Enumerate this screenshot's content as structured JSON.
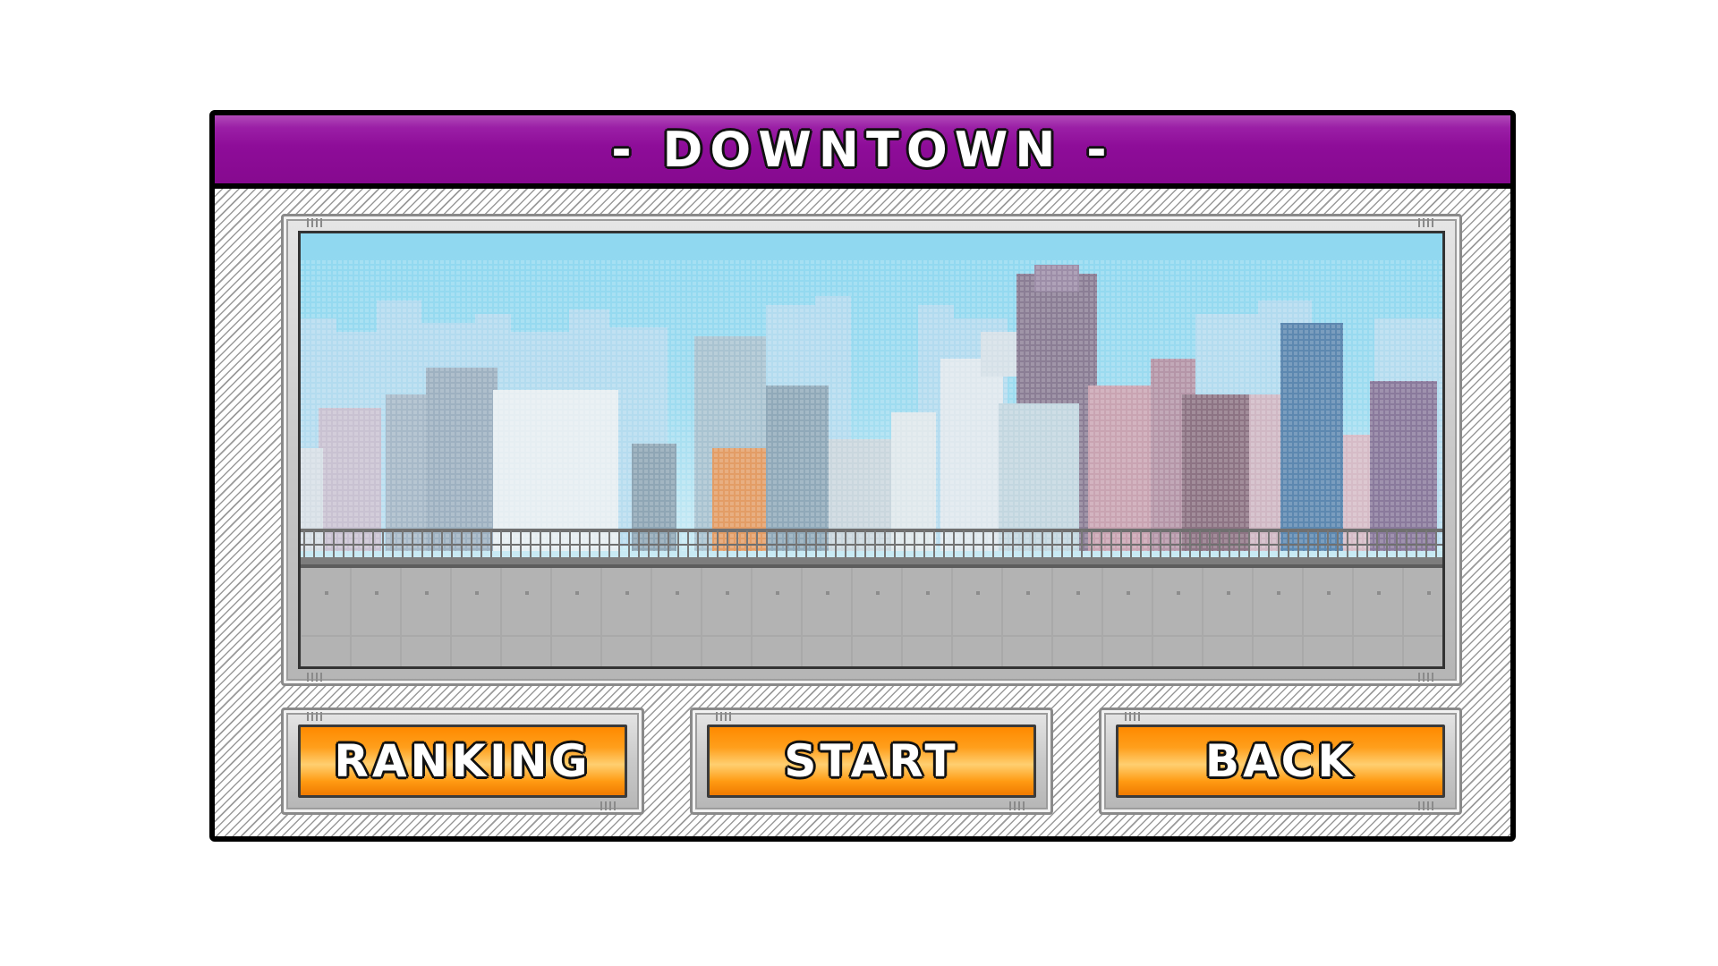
{
  "stage": {
    "title": "- DOWNTOWN -"
  },
  "buttons": {
    "ranking": "RANKING",
    "start": "START",
    "back": "BACK"
  },
  "colors": {
    "title_bar": "#8e0d99",
    "button": "#ff9a12",
    "sky": "#9fdcf0"
  }
}
